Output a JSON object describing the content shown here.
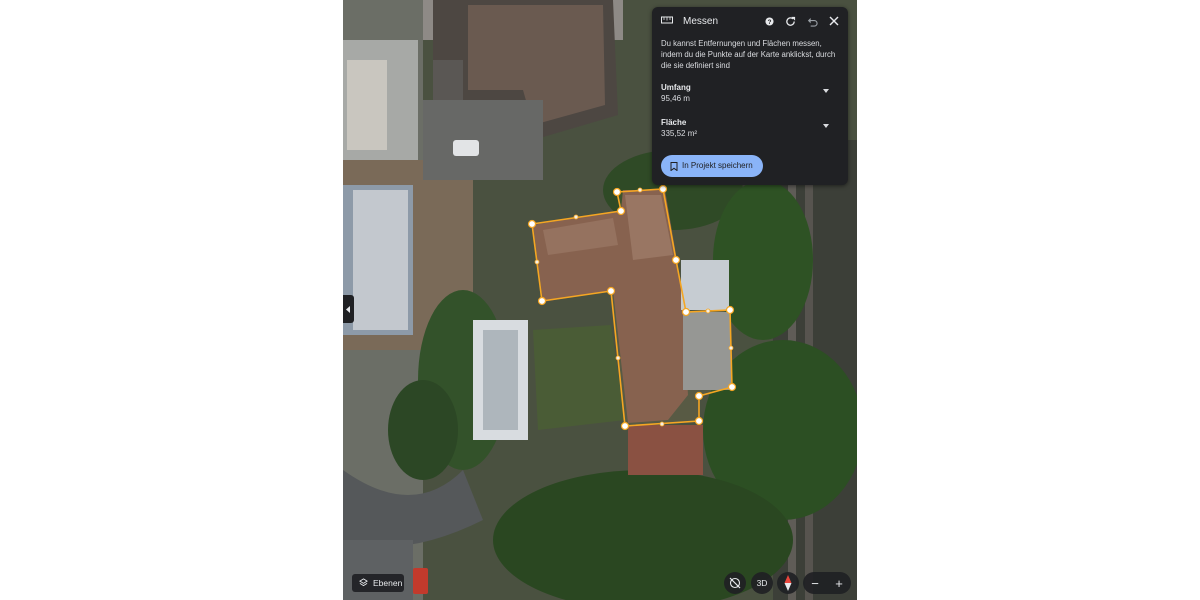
{
  "measure_panel": {
    "title": "Messen",
    "description": "Du kannst Entfernungen und Flächen messen, indem du die Punkte auf der Karte anklickst, durch die sie definiert sind",
    "perimeter": {
      "label": "Umfang",
      "value": "95,46 m"
    },
    "area": {
      "label": "Fläche",
      "value": "335,52 m²"
    },
    "save_label": "In Projekt speichern",
    "icons": [
      "ruler-icon",
      "help-icon",
      "refresh-icon",
      "undo-icon",
      "close-icon",
      "bookmark-icon"
    ]
  },
  "map_controls": {
    "layers_label": "Ebenen",
    "view_3d_label": "3D",
    "zoom_out_label": "−",
    "zoom_in_label": "+",
    "icons": [
      "layers-icon",
      "tilt-off-icon",
      "compass-icon",
      "chevron-left-icon"
    ]
  },
  "colors": {
    "panel_bg": "#202124",
    "accent_button": "#8ab4f8",
    "measure_line": "#f5a623"
  }
}
